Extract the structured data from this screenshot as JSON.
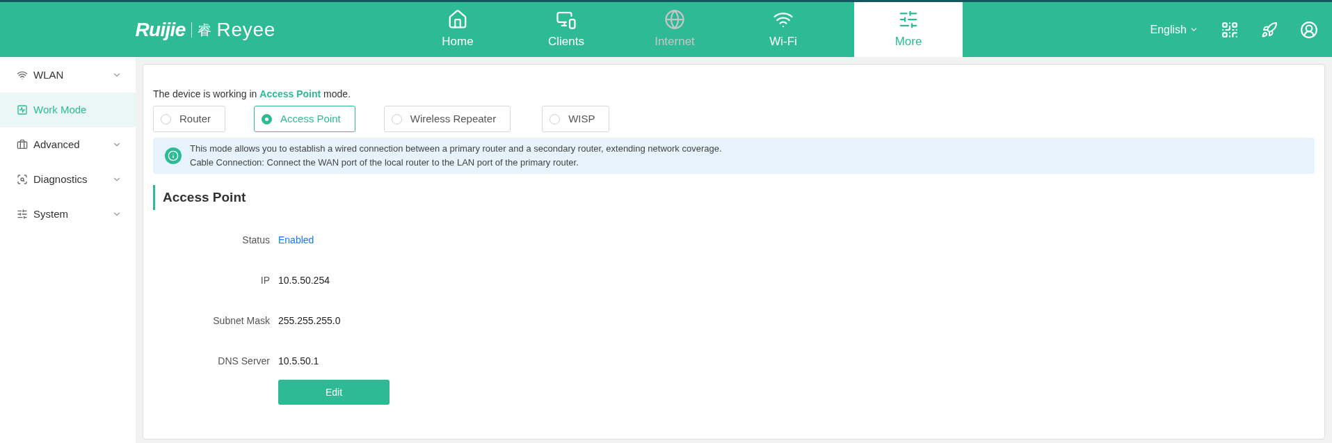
{
  "header": {
    "logo": {
      "brand": "Ruijie",
      "mark": "睿",
      "product": "Reyee"
    },
    "nav": [
      {
        "label": "Home",
        "selected": false,
        "disabled": false
      },
      {
        "label": "Clients",
        "selected": false,
        "disabled": false
      },
      {
        "label": "Internet",
        "selected": false,
        "disabled": true
      },
      {
        "label": "Wi-Fi",
        "selected": false,
        "disabled": false
      },
      {
        "label": "More",
        "selected": true,
        "disabled": false
      }
    ],
    "language": "English"
  },
  "sidebar": {
    "items": [
      {
        "label": "WLAN",
        "selected": false,
        "expandable": true
      },
      {
        "label": "Work Mode",
        "selected": true,
        "expandable": false
      },
      {
        "label": "Advanced",
        "selected": false,
        "expandable": true
      },
      {
        "label": "Diagnostics",
        "selected": false,
        "expandable": true
      },
      {
        "label": "System",
        "selected": false,
        "expandable": true
      }
    ]
  },
  "main": {
    "intro": "The device is working in **Access Point** mode.",
    "modes": [
      {
        "label": "Router",
        "selected": false
      },
      {
        "label": "Access Point",
        "selected": true
      },
      {
        "label": "Wireless Repeater",
        "selected": false
      },
      {
        "label": "WISP",
        "selected": false
      }
    ],
    "info": [
      "This mode allows you to establish a wired connection between a primary router and a secondary router, extending network coverage.",
      "Cable Connection: Connect the WAN port of the local router to the LAN port of the primary router."
    ],
    "section_title": "Access Point",
    "fields": [
      {
        "label": "Status",
        "value": "Enabled",
        "kind": "status"
      },
      {
        "label": "IP",
        "value": "10.5.50.254",
        "kind": "text"
      },
      {
        "label": "Subnet Mask",
        "value": "255.255.255.0",
        "kind": "text"
      },
      {
        "label": "DNS Server",
        "value": "10.5.50.1",
        "kind": "text"
      }
    ],
    "edit_button": "Edit"
  }
}
